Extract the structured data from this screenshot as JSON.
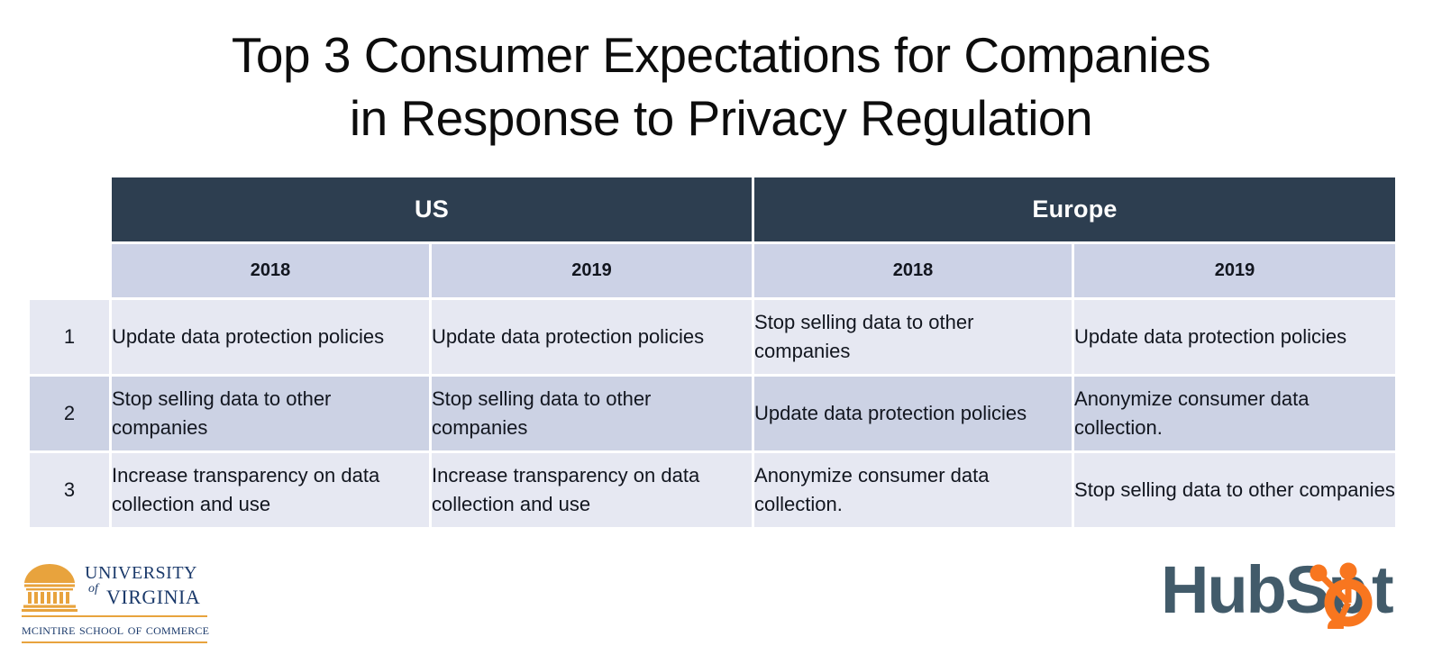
{
  "title": {
    "line1": "Top 3 Consumer Expectations for Companies",
    "line2": "in Response to Privacy Regulation"
  },
  "colors": {
    "header_navy": "#2d3e50",
    "subheader_blue": "#ccd2e6",
    "row_light": "#e6e8f2",
    "row_alt": "#ccd2e4",
    "uva_navy": "#1b3a6b",
    "uva_orange": "#e8a33d",
    "hubspot_slate": "#425b6a",
    "hubspot_orange": "#f8761f"
  },
  "table": {
    "regions": [
      {
        "label": "US"
      },
      {
        "label": "Europe"
      }
    ],
    "year_headers": [
      "2018",
      "2019",
      "2018",
      "2019"
    ],
    "rank_labels": [
      "1",
      "2",
      "3"
    ],
    "rows": [
      {
        "rank": "1",
        "us_2018": "Update data protection policies",
        "us_2019": "Update data protection policies",
        "eu_2018": "Stop selling data to other companies",
        "eu_2019": "Update data protection policies"
      },
      {
        "rank": "2",
        "us_2018": "Stop selling data to other companies",
        "us_2019": "Stop selling data to other companies",
        "eu_2018": "Update data protection policies",
        "eu_2019": "Anonymize consumer data collection."
      },
      {
        "rank": "3",
        "us_2018": "Increase transparency on data collection and use",
        "us_2019": "Increase transparency on data collection and use",
        "eu_2018": "Anonymize consumer data collection.",
        "eu_2019": "Stop selling data to other companies"
      }
    ]
  },
  "uva_logo": {
    "university": "University",
    "of": "of",
    "virginia": "Virginia",
    "school": "McIntire School of Commerce"
  },
  "hubspot_logo": {
    "text_start": "HubSp",
    "text_end": "t"
  }
}
